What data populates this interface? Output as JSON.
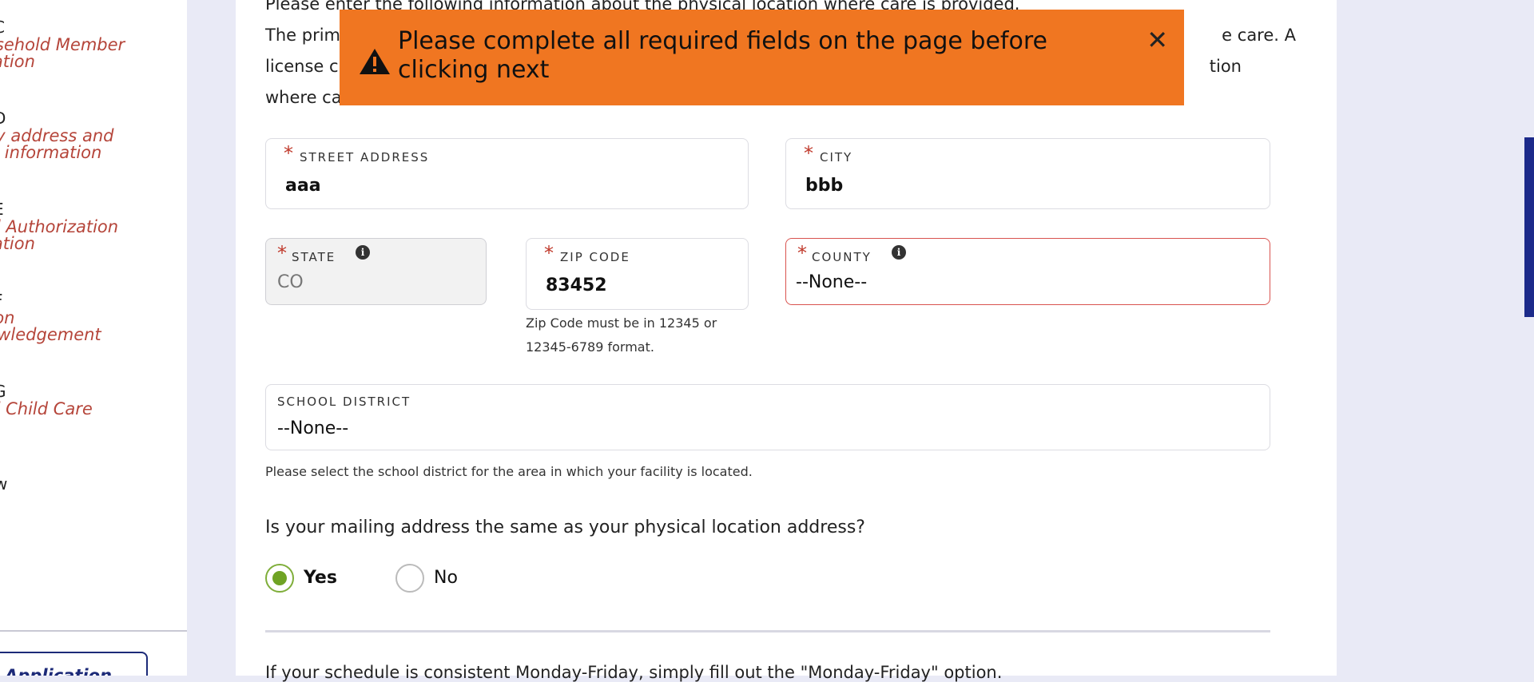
{
  "sidebar": {
    "steps": [
      {
        "letter": "C",
        "title_line1": "Household Member",
        "title_line2": "Information"
      },
      {
        "letter": "D",
        "title_line1": "Facility address and",
        "title_line2": "contacting information"
      },
      {
        "letter": "E",
        "title_line1": "Background Authorization",
        "title_line2": "Information"
      },
      {
        "letter": "F",
        "title_line1": "Certification",
        "title_line2": "Acknowledgement"
      },
      {
        "letter": "G",
        "title_line1": "Experienced Child Care",
        "title_line2": ""
      },
      {
        "letter": "H",
        "title_line1": "Review",
        "title_line2": ""
      }
    ],
    "app_button_label": "Application"
  },
  "intro": {
    "line1": "Please enter the following information about the physical location where care is provided.",
    "line2_start": "The prim",
    "line2_end": "e care. A",
    "line3_start": "license c",
    "line3_end": "tion",
    "line4_start": "where ca"
  },
  "toast": {
    "message": "Please complete all required fields on the page before clicking next",
    "close_glyph": "✕",
    "color": "#f07621"
  },
  "form": {
    "street": {
      "label": "STREET ADDRESS",
      "value": "aaa",
      "required": "*"
    },
    "city": {
      "label": "CITY",
      "value": "bbb",
      "required": "*"
    },
    "state": {
      "label": "STATE",
      "value": "CO",
      "required": "*",
      "info": "i"
    },
    "zip": {
      "label": "ZIP CODE",
      "value": "83452",
      "required": "*",
      "help_line1": "Zip Code must be in 12345 or",
      "help_line2": "12345-6789 format."
    },
    "county": {
      "label": "COUNTY",
      "value": "--None--",
      "required": "*",
      "info": "i"
    },
    "school_district": {
      "label": "SCHOOL DISTRICT",
      "value": "--None--",
      "help": "Please select the school district for the area in which your facility is located."
    }
  },
  "mailing": {
    "question": "Is your mailing address the same as your physical location address?",
    "yes": "Yes",
    "no": "No",
    "selected": "Yes"
  },
  "schedule_text": "If your schedule is consistent Monday-Friday, simply fill out the \"Monday-Friday\" option."
}
